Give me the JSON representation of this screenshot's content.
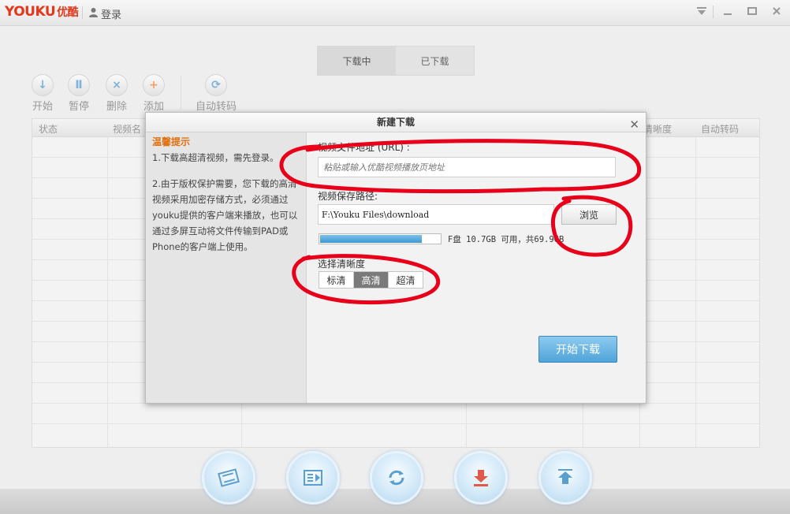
{
  "app": {
    "logo_text": "YOUKU",
    "logo_cn": "优酷",
    "login_label": "登录"
  },
  "tabs": [
    {
      "label": "下载中",
      "active": true
    },
    {
      "label": "已下载",
      "active": false
    }
  ],
  "toolbar": {
    "start": "开始",
    "pause": "暂停",
    "delete": "删除",
    "add": "添加",
    "auto_convert": "自动转码"
  },
  "table": {
    "columns": [
      "状态",
      "视频名",
      "清晰度",
      "自动转码"
    ]
  },
  "dialog": {
    "title": "新建下载",
    "close_icon": "close-icon",
    "tips": {
      "title": "温馨提示",
      "item1": "1.下载高超清视频，需先登录。",
      "item2": "2.由于版权保护需要，您下载的高清视频采用加密存储方式，必须通过youku提供的客户端来播放，也可以通过多屏互动将文件传输到PAD或Phone的客户端上使用。"
    },
    "url": {
      "label": "视频文件地址 (URL) :",
      "placeholder": "粘贴或输入优酷视频播放页地址",
      "value": ""
    },
    "save_path": {
      "label": "视频保存路径:",
      "value": "F:\\Youku Files\\download",
      "browse_label": "浏览"
    },
    "disk": {
      "used_fraction": 0.85,
      "text": "F盘 10.7GB 可用，共69.9GB"
    },
    "quality": {
      "label": "选择清晰度",
      "options": [
        "标清",
        "高清",
        "超清"
      ],
      "selected": "高清"
    },
    "start_download_label": "开始下载"
  },
  "annotation_color": "#e8001a"
}
